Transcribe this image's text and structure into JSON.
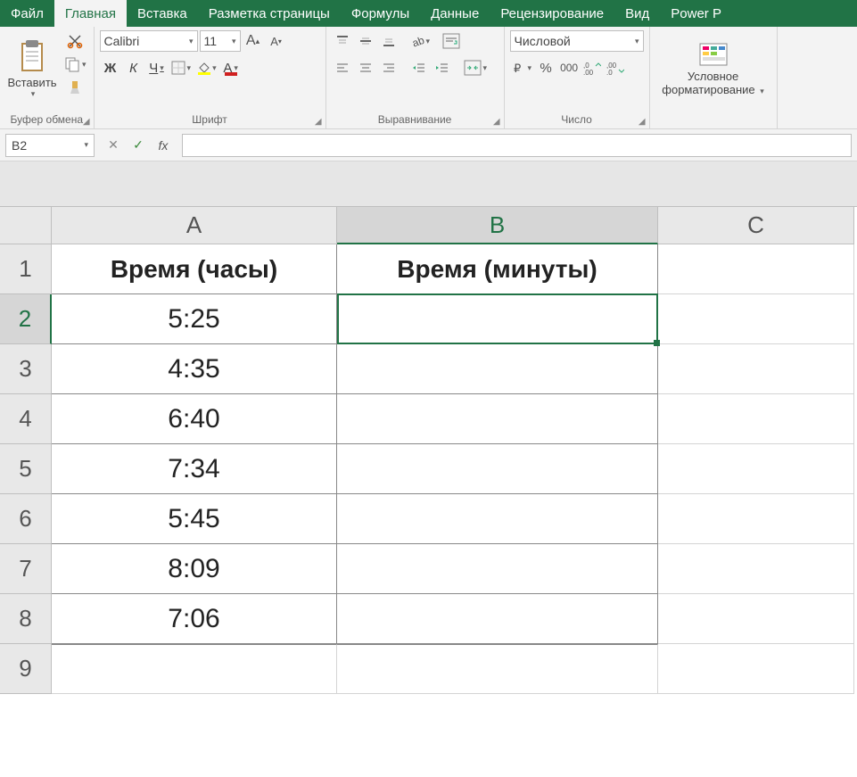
{
  "tabs": {
    "file": "Файл",
    "home": "Главная",
    "insert": "Вставка",
    "layout": "Разметка страницы",
    "formulas": "Формулы",
    "data": "Данные",
    "review": "Рецензирование",
    "view": "Вид",
    "powerp": "Power P"
  },
  "ribbon": {
    "clipboard": {
      "paste": "Вставить",
      "group": "Буфер обмена"
    },
    "font": {
      "name": "Calibri",
      "size": "11",
      "group": "Шрифт",
      "bold": "Ж",
      "italic": "К",
      "underline": "Ч"
    },
    "align": {
      "group": "Выравнивание"
    },
    "number": {
      "format": "Числовой",
      "group": "Число"
    },
    "cond": {
      "line1": "Условное",
      "line2": "форматирование",
      "drop": ""
    }
  },
  "fbar": {
    "cellref": "B2",
    "fx": "fx",
    "formula": ""
  },
  "sheet": {
    "cols": [
      "A",
      "B",
      "C"
    ],
    "rows": [
      "1",
      "2",
      "3",
      "4",
      "5",
      "6",
      "7",
      "8",
      "9"
    ],
    "headers": {
      "A": "Время (часы)",
      "B": "Время (минуты)"
    },
    "dataA": [
      "5:25",
      "4:35",
      "6:40",
      "7:34",
      "5:45",
      "8:09",
      "7:06"
    ],
    "selected": "B2"
  }
}
